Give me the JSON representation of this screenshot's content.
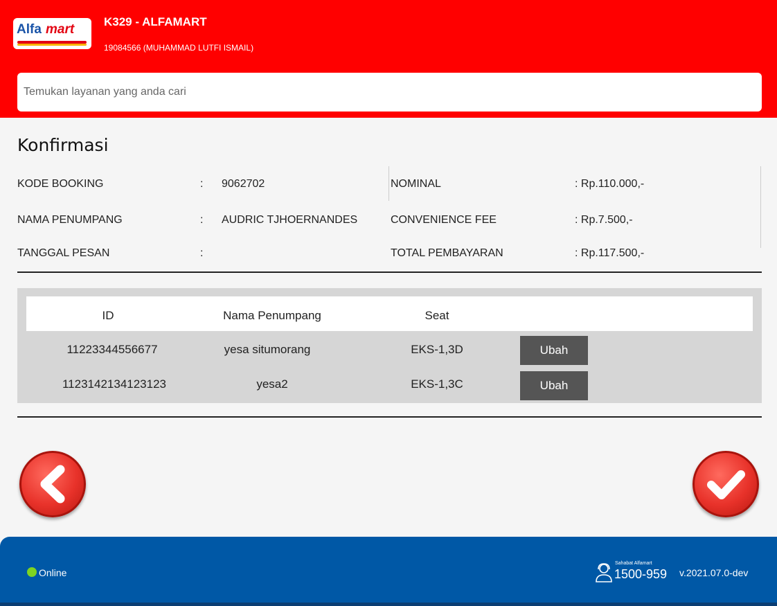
{
  "header": {
    "logo_alfa": "Alfa",
    "logo_mart": "mart",
    "store_name": "K329 - ALFAMART",
    "user_info": "19084566 (MUHAMMAD LUTFI ISMAIL)",
    "search_placeholder": "Temukan layanan yang anda cari"
  },
  "page": {
    "title": "Konfirmasi"
  },
  "details": {
    "separator": ":",
    "left": [
      {
        "label": "KODE BOOKING",
        "value": "9062702"
      },
      {
        "label": "NAMA PENUMPANG",
        "value": "AUDRIC TJHOERNANDES"
      },
      {
        "label": "TANGGAL PESAN",
        "value": ""
      }
    ],
    "right": [
      {
        "label": "NOMINAL",
        "value": ": Rp.110.000,-"
      },
      {
        "label": "CONVENIENCE FEE",
        "value": ": Rp.7.500,-"
      },
      {
        "label": "TOTAL PEMBAYARAN",
        "value": ": Rp.117.500,-"
      }
    ]
  },
  "table": {
    "columns": [
      "ID",
      "Nama Penumpang",
      "Seat"
    ],
    "rows": [
      {
        "id": "11223344556677",
        "name": "yesa situmorang",
        "seat": "EKS-1,3D",
        "action": "Ubah"
      },
      {
        "id": "1123142134123123",
        "name": "yesa2",
        "seat": "EKS-1,3C",
        "action": "Ubah"
      }
    ]
  },
  "icons": {
    "back": "chevron-left-icon",
    "confirm": "checkmark-icon",
    "support": "headset-icon"
  },
  "footer": {
    "status": "Online",
    "support_label": "Sahabat Alfamart",
    "support_number": "1500-959",
    "version": "v.2021.07.0-dev"
  },
  "colors": {
    "header": "#ff0000",
    "footer": "#0058a6",
    "button": "#555555",
    "online": "#7ed321",
    "action_red": "#e8322a"
  }
}
